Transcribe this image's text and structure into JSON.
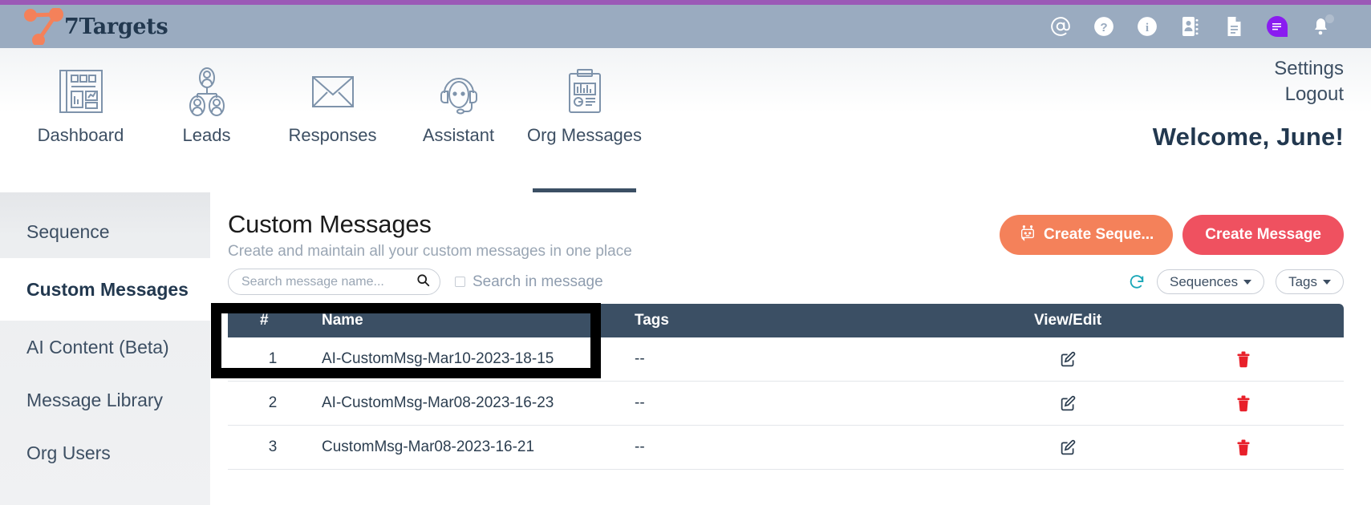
{
  "brand": {
    "name": "7Targets",
    "logo_icon": "seven-targets-logo-icon",
    "accent": "#f4815a"
  },
  "topbar": {
    "background": "#9aabc0",
    "accent_bar": "#9b59b6",
    "icons": [
      {
        "name": "at-mention-icon",
        "label": "@"
      },
      {
        "name": "help-question-icon",
        "label": "?"
      },
      {
        "name": "info-icon",
        "label": "i"
      },
      {
        "name": "contacts-book-icon",
        "label": "Contacts"
      },
      {
        "name": "document-icon",
        "label": "Documents"
      },
      {
        "name": "purple-app-icon",
        "label": "App"
      },
      {
        "name": "notification-bell-icon",
        "label": "Notifications"
      }
    ]
  },
  "nav": {
    "items": [
      {
        "label": "Dashboard",
        "icon": "dashboard-icon",
        "active": false
      },
      {
        "label": "Leads",
        "icon": "leads-people-icon",
        "active": false
      },
      {
        "label": "Responses",
        "icon": "envelope-icon",
        "active": false
      },
      {
        "label": "Assistant",
        "icon": "headset-agent-icon",
        "active": false
      },
      {
        "label": "Org Messages",
        "icon": "clipboard-chart-icon",
        "active": true
      }
    ],
    "settings_label": "Settings",
    "logout_label": "Logout",
    "welcome": "Welcome, June!"
  },
  "sidebar": {
    "items": [
      {
        "label": "Sequence",
        "active": false
      },
      {
        "label": "Custom Messages",
        "active": true
      },
      {
        "label": "AI Content (Beta)",
        "active": false
      },
      {
        "label": "Message Library",
        "active": false
      },
      {
        "label": "Org Users",
        "active": false
      }
    ]
  },
  "main": {
    "title": "Custom Messages",
    "subtitle": "Create and maintain all your custom messages in one place",
    "buttons": {
      "create_sequence": {
        "label": "Create Seque...",
        "icon": "robot-icon",
        "color": "#f4815a"
      },
      "create_message": {
        "label": "Create Message",
        "color": "#ef5160"
      }
    },
    "search": {
      "placeholder": "Search message name...",
      "value": "",
      "icon": "search-icon",
      "checkbox_label": "Search in message",
      "checkbox_checked": false
    },
    "filters": {
      "refresh_icon": "refresh-icon",
      "sequences_label": "Sequences",
      "tags_label": "Tags"
    },
    "table": {
      "columns": [
        "#",
        "Name",
        "Tags",
        "View/Edit",
        ""
      ],
      "rows": [
        {
          "num": "1",
          "name": "AI-CustomMsg-Mar10-2023-18-15",
          "tags": "--",
          "edit_icon": "edit-pencil-icon",
          "delete_icon": "trash-icon"
        },
        {
          "num": "2",
          "name": "AI-CustomMsg-Mar08-2023-16-23",
          "tags": "--",
          "edit_icon": "edit-pencil-icon",
          "delete_icon": "trash-icon"
        },
        {
          "num": "3",
          "name": "CustomMsg-Mar08-2023-16-21",
          "tags": "--",
          "edit_icon": "edit-pencil-icon",
          "delete_icon": "trash-icon"
        }
      ]
    }
  },
  "annotation": {
    "shape": "rectangle",
    "color": "#000000",
    "target": "first-table-row-name-cell"
  }
}
